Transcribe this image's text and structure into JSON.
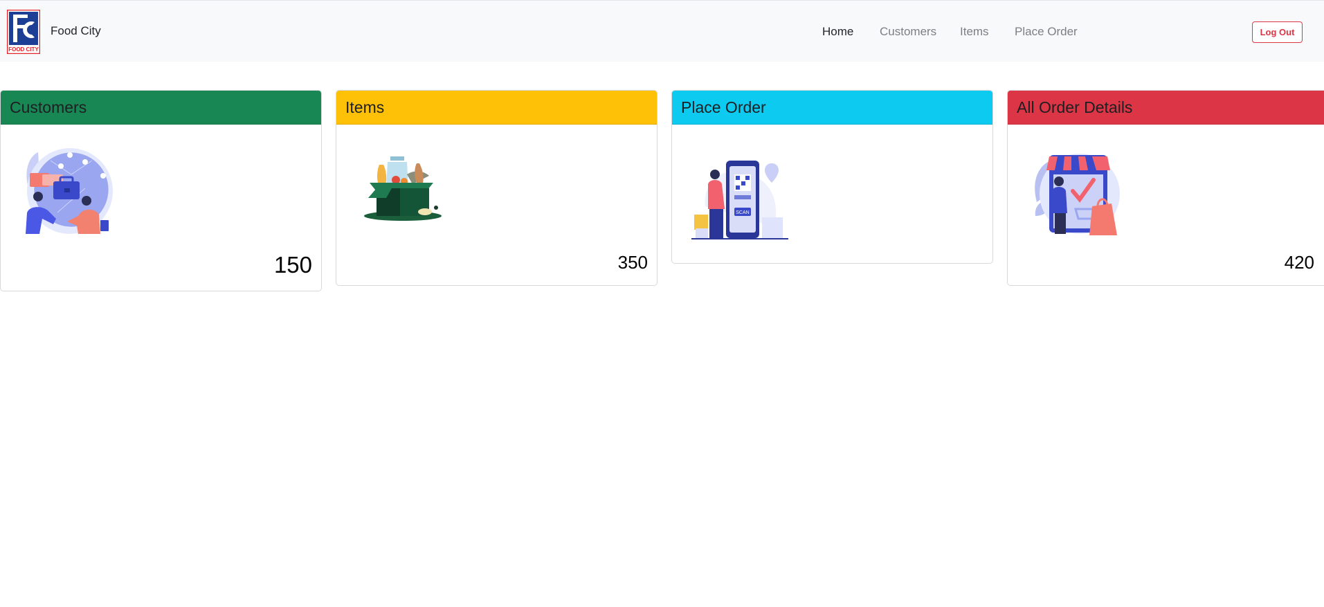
{
  "brand": {
    "name": "Food City",
    "logo_text": "FOOD CITY",
    "logo_mark": "FC"
  },
  "nav": {
    "items": [
      {
        "label": "Home",
        "active": true
      },
      {
        "label": "Customers",
        "active": false
      },
      {
        "label": "Items",
        "active": false
      },
      {
        "label": "Place Order",
        "active": false
      }
    ],
    "logout_label": "Log Out"
  },
  "cards": [
    {
      "title": "Customers",
      "count": "150",
      "color": "#198754",
      "illustration": "handshake-globe"
    },
    {
      "title": "Items",
      "count": "350",
      "color": "#ffc107",
      "illustration": "grocery-box"
    },
    {
      "title": "Place Order",
      "count": "",
      "color": "#0dcaf0",
      "illustration": "qr-scan-kiosk"
    },
    {
      "title": "All Order Details",
      "count": "420",
      "color": "#dc3545",
      "illustration": "online-shop"
    }
  ],
  "illustration_texts": {
    "scan": "SCAN"
  }
}
